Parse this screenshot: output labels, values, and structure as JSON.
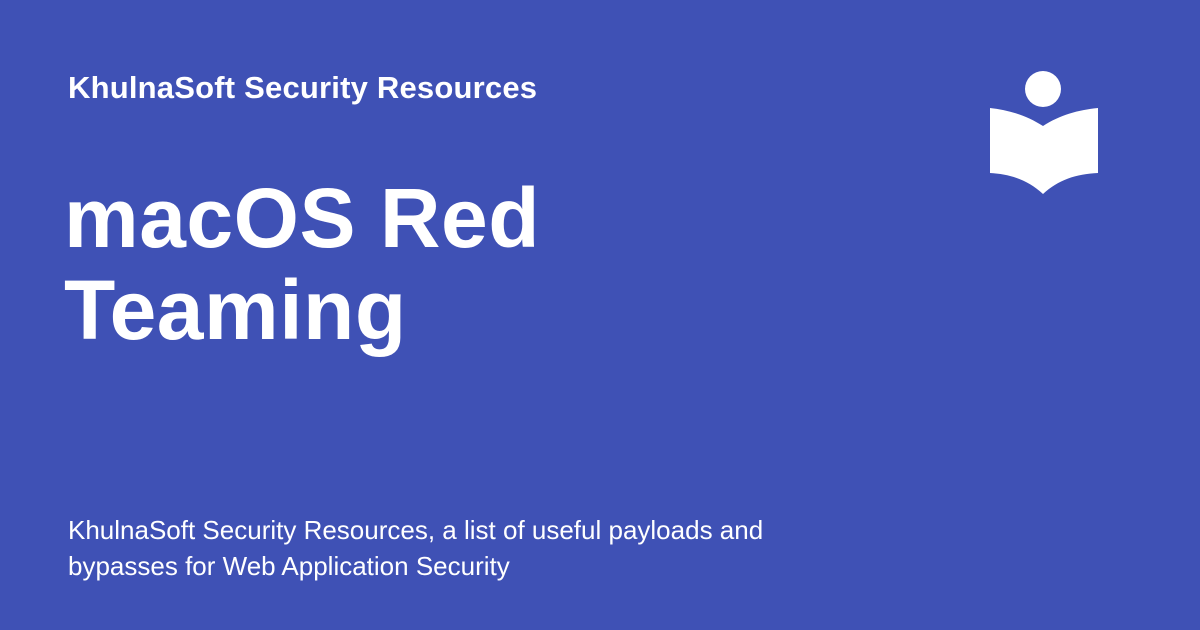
{
  "site": {
    "name": "KhulnaSoft Security Resources"
  },
  "page": {
    "title": "macOS Red Teaming",
    "description": "KhulnaSoft Security Resources, a list of useful payloads and bypasses for Web Application Security"
  },
  "logo": {
    "icon": "book-reader-icon",
    "color": "#ffffff"
  },
  "colors": {
    "background": "#3f51b5",
    "text": "#ffffff"
  }
}
